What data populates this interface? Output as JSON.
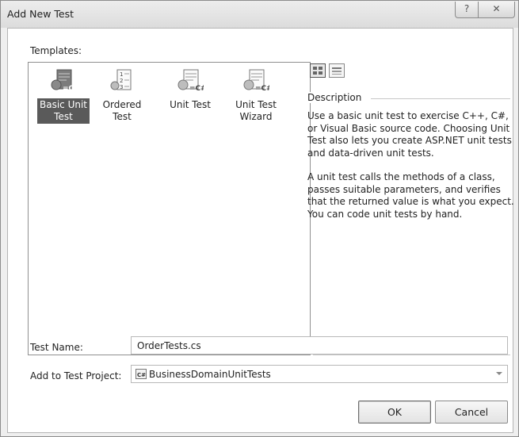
{
  "window": {
    "title": "Add New Test",
    "help_glyph": "?",
    "close_glyph": "✕"
  },
  "templates": {
    "label": "Templates:",
    "items": [
      {
        "label": "Basic Unit Test",
        "icon": "basic-unit-test-icon",
        "selected": true
      },
      {
        "label": "Ordered Test",
        "icon": "ordered-test-icon",
        "selected": false
      },
      {
        "label": "Unit Test",
        "icon": "unit-test-icon",
        "selected": false
      },
      {
        "label": "Unit Test Wizard",
        "icon": "unit-test-wizard-icon",
        "selected": false
      }
    ]
  },
  "view_buttons": [
    "large-icons-view-icon",
    "details-view-icon"
  ],
  "description": {
    "heading": "Description",
    "paragraphs": [
      "Use a basic unit test to exercise C++, C#, or Visual Basic source code. Choosing Unit Test also lets you create ASP.NET unit tests and data-driven unit tests.",
      "A unit test calls the methods of a class, passes suitable parameters, and verifies that the returned value is what you expect. You can code unit tests by hand."
    ]
  },
  "form": {
    "test_name_label": "Test Name:",
    "test_name_value": "OrderTests.cs",
    "project_label": "Add to Test Project:",
    "project_value": "BusinessDomainUnitTests",
    "project_icon": "csharp-project-icon"
  },
  "buttons": {
    "ok": "OK",
    "cancel": "Cancel"
  },
  "colors": {
    "selected_item_bg": "#5a5a5a",
    "window_frame": "#efefef"
  }
}
